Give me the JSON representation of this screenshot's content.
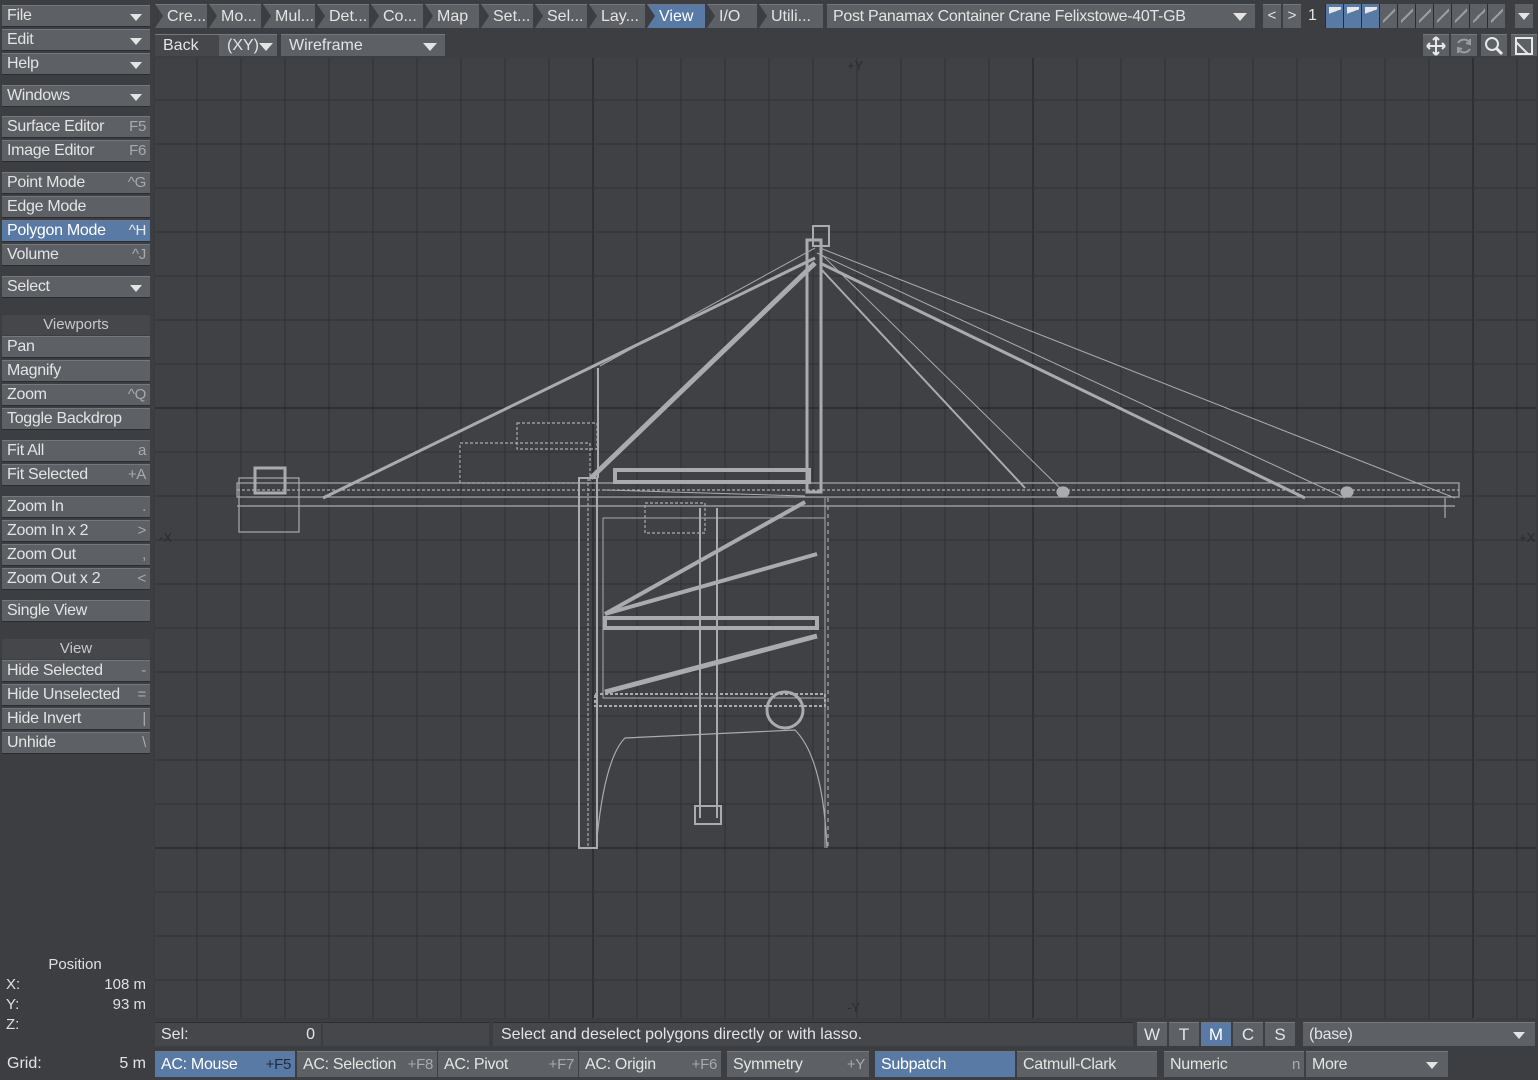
{
  "left_menu": {
    "file": "File",
    "edit": "Edit",
    "help": "Help",
    "windows": "Windows",
    "surface_editor": "Surface Editor",
    "surface_editor_key": "F5",
    "image_editor": "Image Editor",
    "image_editor_key": "F6",
    "point_mode": "Point Mode",
    "point_mode_key": "^G",
    "edge_mode": "Edge Mode",
    "polygon_mode": "Polygon Mode",
    "polygon_mode_key": "^H",
    "volume": "Volume",
    "volume_key": "^J",
    "select": "Select",
    "viewports_header": "Viewports",
    "pan": "Pan",
    "magnify": "Magnify",
    "zoom": "Zoom",
    "zoom_key": "^Q",
    "toggle_backdrop": "Toggle Backdrop",
    "fit_all": "Fit All",
    "fit_all_key": "a",
    "fit_selected": "Fit Selected",
    "fit_selected_key": "+A",
    "zoom_in": "Zoom In",
    "zoom_in_key": ".",
    "zoom_in_x2": "Zoom In x 2",
    "zoom_in_x2_key": ">",
    "zoom_out": "Zoom Out",
    "zoom_out_key": ",",
    "zoom_out_x2": "Zoom Out x 2",
    "zoom_out_x2_key": "<",
    "single_view": "Single View",
    "view_header": "View",
    "hide_selected": "Hide Selected",
    "hide_selected_key": "-",
    "hide_unselected": "Hide Unselected",
    "hide_unselected_key": "=",
    "hide_invert": "Hide Invert",
    "hide_invert_key": "|",
    "unhide": "Unhide",
    "unhide_key": "\\"
  },
  "position": {
    "title": "Position",
    "x_label": "X:",
    "x_value": "108 m",
    "y_label": "Y:",
    "y_value": "93 m",
    "z_label": "Z:",
    "z_value": ""
  },
  "tabs": [
    {
      "label": "Cre..."
    },
    {
      "label": "Mo..."
    },
    {
      "label": "Mul..."
    },
    {
      "label": "Det..."
    },
    {
      "label": "Co..."
    },
    {
      "label": "Map"
    },
    {
      "label": "Set..."
    },
    {
      "label": "Sel..."
    },
    {
      "label": "Lay..."
    },
    {
      "label": "View",
      "active": true
    },
    {
      "label": "I/O"
    },
    {
      "label": "Utili..."
    }
  ],
  "object_name": "Post Panamax Container Crane Felixstowe-40T-GB",
  "nav": {
    "prev": "<",
    "next": ">",
    "layer_number": "1"
  },
  "viewport_header": {
    "view": "Back",
    "axis": "(XY)",
    "render_mode": "Wireframe"
  },
  "viewport_icons": [
    "move-icon",
    "rotate-icon",
    "zoom-icon",
    "maximize-icon"
  ],
  "axis_labels": {
    "top": "+Y",
    "bottom": "-Y",
    "left": "-X",
    "right": "+X"
  },
  "status": {
    "sel_label": "Sel:",
    "sel_count": "0",
    "message": "Select and deselect polygons directly or with lasso.",
    "wtmcs": [
      "W",
      "T",
      "M",
      "C",
      "S"
    ],
    "active_wtmcs": "M",
    "layer": "(base)"
  },
  "bottom": {
    "grid_label": "Grid:",
    "grid_value": "5 m",
    "ac_mouse": "AC: Mouse",
    "ac_mouse_key": "+F5",
    "ac_selection": "AC: Selection",
    "ac_selection_key": "+F8",
    "ac_pivot": "AC: Pivot",
    "ac_pivot_key": "+F7",
    "ac_origin": "AC: Origin",
    "ac_origin_key": "+F6",
    "symmetry": "Symmetry",
    "symmetry_key": "+Y",
    "subpatch": "Subpatch",
    "catmull_clark": "Catmull-Clark",
    "numeric": "Numeric",
    "numeric_key": "n",
    "more": "More"
  },
  "colors": {
    "accent": "#5a7aa6",
    "panel": "#3c3e42",
    "button": "#5d6064",
    "viewport": "#3f4145",
    "wire": "#a9abae"
  }
}
